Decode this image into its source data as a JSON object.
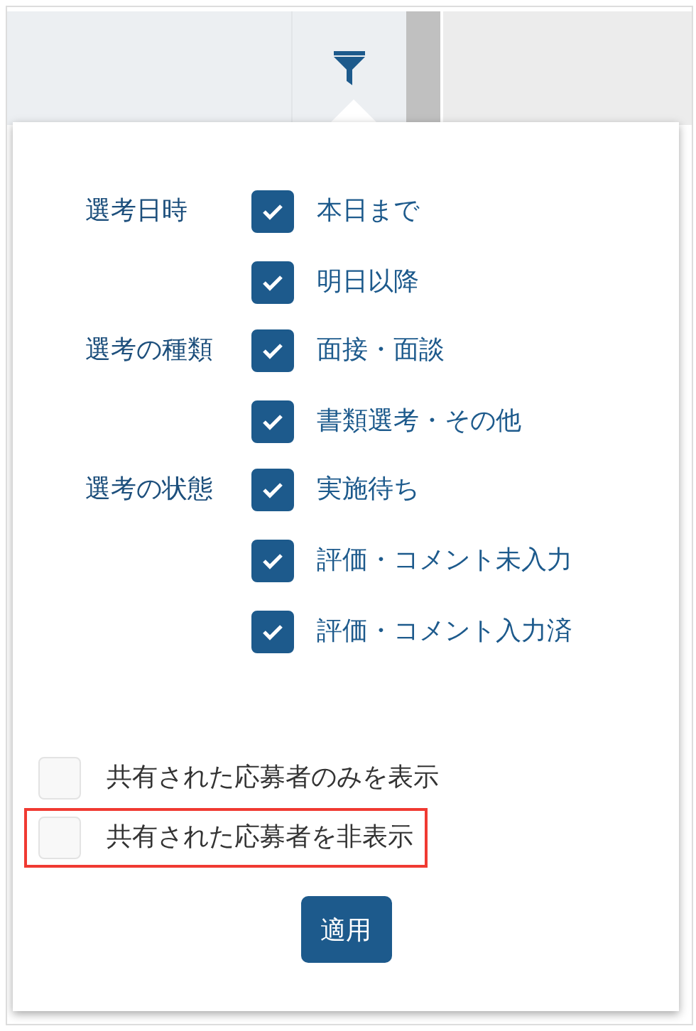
{
  "groups": [
    {
      "label": "選考日時",
      "options": [
        {
          "label": "本日まで",
          "checked": true
        },
        {
          "label": "明日以降",
          "checked": true
        }
      ]
    },
    {
      "label": "選考の種類",
      "options": [
        {
          "label": "面接・面談",
          "checked": true
        },
        {
          "label": "書類選考・その他",
          "checked": true
        }
      ]
    },
    {
      "label": "選考の状態",
      "options": [
        {
          "label": "実施待ち",
          "checked": true
        },
        {
          "label": "評価・コメント未入力",
          "checked": true
        },
        {
          "label": "評価・コメント入力済",
          "checked": true
        }
      ]
    }
  ],
  "shared_options": [
    {
      "label": "共有された応募者のみを表示",
      "checked": false,
      "highlighted": false
    },
    {
      "label": "共有された応募者を非表示",
      "checked": false,
      "highlighted": true
    }
  ],
  "apply_button": "適用"
}
